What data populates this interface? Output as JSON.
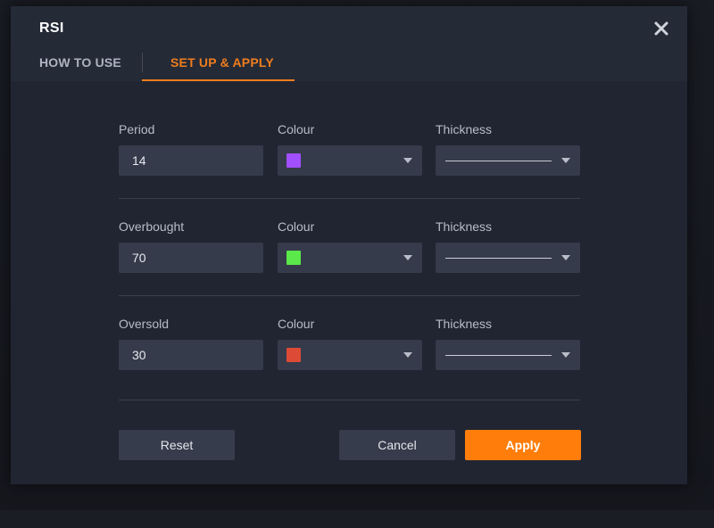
{
  "dialog": {
    "title": "RSI",
    "close_icon": "close-icon"
  },
  "tabs": [
    {
      "label": "HOW TO USE",
      "active": false
    },
    {
      "label": "SET UP & APPLY",
      "active": true
    }
  ],
  "colors": {
    "accent": "#ef7d1c",
    "apply_button": "#ff7d0a"
  },
  "rows": [
    {
      "value_label": "Period",
      "value": "14",
      "colour_label": "Colour",
      "colour": "#a14fff",
      "thickness_label": "Thickness",
      "thickness": "thin-line"
    },
    {
      "value_label": "Overbought",
      "value": "70",
      "colour_label": "Colour",
      "colour": "#5ae84a",
      "thickness_label": "Thickness",
      "thickness": "thin-line"
    },
    {
      "value_label": "Oversold",
      "value": "30",
      "colour_label": "Colour",
      "colour": "#dd4b37",
      "thickness_label": "Thickness",
      "thickness": "thin-line"
    }
  ],
  "buttons": {
    "reset": "Reset",
    "cancel": "Cancel",
    "apply": "Apply"
  }
}
